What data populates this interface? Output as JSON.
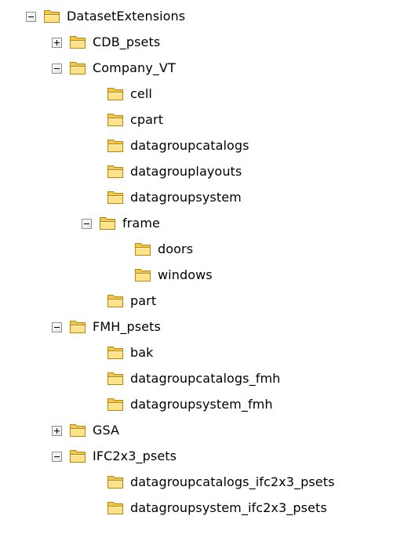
{
  "tree": {
    "root": {
      "label": "DatasetExtensions",
      "icon": "folder-icon",
      "state": "expanded"
    },
    "items": [
      {
        "label": "CDB_psets",
        "icon": "folder-icon",
        "state": "collapsed"
      },
      {
        "label": "Company_VT",
        "icon": "folder-icon",
        "state": "expanded"
      },
      {
        "label": "cell",
        "icon": "folder-icon",
        "state": "leaf"
      },
      {
        "label": "cpart",
        "icon": "folder-icon",
        "state": "leaf"
      },
      {
        "label": "datagroupcatalogs",
        "icon": "folder-icon",
        "state": "leaf"
      },
      {
        "label": "datagrouplayouts",
        "icon": "folder-icon",
        "state": "leaf"
      },
      {
        "label": "datagroupsystem",
        "icon": "folder-icon",
        "state": "leaf"
      },
      {
        "label": "frame",
        "icon": "folder-icon",
        "state": "expanded"
      },
      {
        "label": "doors",
        "icon": "folder-icon",
        "state": "leaf"
      },
      {
        "label": "windows",
        "icon": "folder-icon",
        "state": "leaf"
      },
      {
        "label": "part",
        "icon": "folder-icon",
        "state": "leaf"
      },
      {
        "label": "FMH_psets",
        "icon": "folder-icon",
        "state": "expanded"
      },
      {
        "label": "bak",
        "icon": "folder-icon",
        "state": "leaf"
      },
      {
        "label": "datagroupcatalogs_fmh",
        "icon": "folder-icon",
        "state": "leaf"
      },
      {
        "label": "datagroupsystem_fmh",
        "icon": "folder-icon",
        "state": "leaf"
      },
      {
        "label": "GSA",
        "icon": "folder-icon",
        "state": "collapsed"
      },
      {
        "label": "IFC2x3_psets",
        "icon": "folder-icon",
        "state": "expanded"
      },
      {
        "label": "datagroupcatalogs_ifc2x3_psets",
        "icon": "folder-icon",
        "state": "leaf"
      },
      {
        "label": "datagroupsystem_ifc2x3_psets",
        "icon": "folder-icon",
        "state": "leaf"
      }
    ]
  },
  "colors": {
    "folder_body": "#f7d66a",
    "folder_front": "#ffe79a",
    "folder_outline": "#b88a1a",
    "expander_border": "#8e8f8f"
  }
}
